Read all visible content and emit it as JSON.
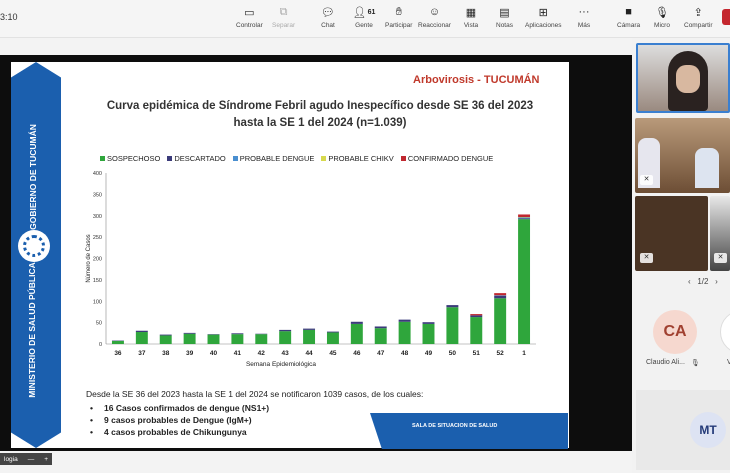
{
  "window": {
    "time": "3:10"
  },
  "toolbar": {
    "items": [
      {
        "label": "Controlar"
      },
      {
        "label": "Separar"
      },
      {
        "label": "Chat"
      },
      {
        "label": "Gente",
        "count": "61"
      },
      {
        "label": "Participar"
      },
      {
        "label": "Reaccionar"
      },
      {
        "label": "Vista"
      },
      {
        "label": "Notas"
      },
      {
        "label": "Aplicaciones"
      },
      {
        "label": "Más"
      },
      {
        "label": "Cámara"
      },
      {
        "label": "Micro"
      },
      {
        "label": "Compartir"
      }
    ]
  },
  "slide": {
    "region": "Arbovirosis - TUCUMÁN",
    "title_line1": "Curva epidémica de Síndrome Febril agudo Inespecífico desde SE 36 del 2023",
    "title_line2": "hasta la SE 1 del 2024 (n=1.039)",
    "banner_top": "GOBIERNO DE TUCUMÁN",
    "banner_bottom": "MINISTERIO DE SALUD PÚBLICA",
    "summary_intro": "Desde la SE 36 del 2023 hasta la SE 1 del 2024 se notificaron 1039 casos, de los cuales:",
    "bullets": [
      "16 Casos confirmados de dengue (NS1+)",
      "9 casos probables de Dengue (IgM+)",
      "4 casos probables de Chikungunya"
    ],
    "footer": "SALA DE SITUACION DE SALUD"
  },
  "chart_data": {
    "type": "bar",
    "xlabel": "Semana Epidemiológica",
    "ylabel": "Número de Casos",
    "ylim": [
      0,
      400
    ],
    "yticks": [
      0,
      50,
      100,
      150,
      200,
      250,
      300,
      350,
      400
    ],
    "categories": [
      "36",
      "37",
      "38",
      "39",
      "40",
      "41",
      "42",
      "43",
      "44",
      "45",
      "46",
      "47",
      "48",
      "49",
      "50",
      "51",
      "52",
      "1"
    ],
    "series": [
      {
        "name": "SOSPECHOSO",
        "color": "#2fa63c",
        "values": [
          7,
          28,
          20,
          24,
          22,
          23,
          23,
          30,
          33,
          27,
          47,
          37,
          52,
          47,
          86,
          63,
          107,
          292
        ]
      },
      {
        "name": "DESCARTADO",
        "color": "#3b3b7a",
        "values": [
          1,
          3,
          2,
          2,
          1,
          2,
          1,
          3,
          3,
          2,
          5,
          4,
          5,
          4,
          5,
          4,
          6,
          2
        ]
      },
      {
        "name": "PROBABLE DENGUE",
        "color": "#4a8fd0",
        "values": [
          0,
          0,
          0,
          0,
          0,
          0,
          0,
          0,
          0,
          0,
          0,
          0,
          0,
          0,
          0,
          0,
          1,
          2
        ]
      },
      {
        "name": "PROBABLE CHIKV",
        "color": "#d7d94e",
        "values": [
          0,
          0,
          0,
          0,
          0,
          0,
          0,
          0,
          0,
          0,
          0,
          0,
          0,
          0,
          0,
          0,
          0,
          1
        ]
      },
      {
        "name": "CONFIRMADO DENGUE",
        "color": "#c0282f",
        "values": [
          0,
          0,
          0,
          0,
          0,
          0,
          0,
          0,
          0,
          0,
          0,
          0,
          0,
          0,
          0,
          3,
          5,
          6
        ]
      }
    ],
    "grid": false,
    "legend": "top"
  },
  "participants": {
    "pager": "1/2",
    "tile_ca": {
      "initials": "CA",
      "name": "Claudio Ali..."
    },
    "tile_v": {
      "name": "V"
    },
    "tile_mt": {
      "initials": "MT"
    }
  },
  "bottom": {
    "zoom_label": "logia",
    "minus": "—",
    "plus": "+"
  }
}
